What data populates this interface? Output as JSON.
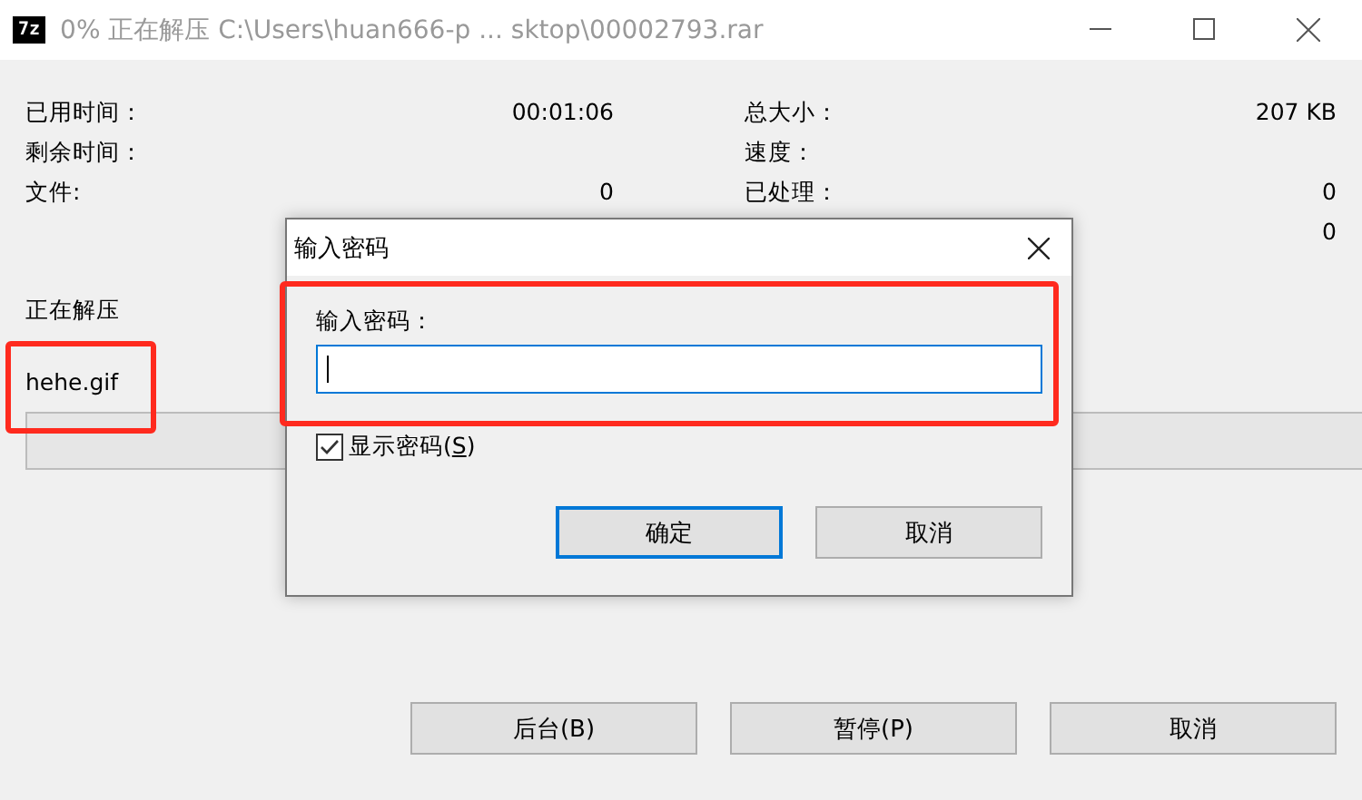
{
  "window": {
    "icon_text": "7z",
    "title": "0% 正在解压 C:\\Users\\huan666-p ... sktop\\00002793.rar"
  },
  "stats_left": [
    {
      "label": "已用时间：",
      "value": "00:01:06"
    },
    {
      "label": "剩余时间："
    },
    {
      "label": "文件:",
      "value": "0"
    }
  ],
  "stats_right": [
    {
      "label": "总大小：",
      "value": "207 KB"
    },
    {
      "label": "速度："
    },
    {
      "label": "已处理：",
      "value": "0"
    },
    {
      "value": "0"
    }
  ],
  "status_label": "正在解压",
  "current_file": "hehe.gif",
  "progress": {
    "level": 0
  },
  "buttons": [
    "后台(B)",
    "暂停(P)",
    "取消"
  ],
  "dialog": {
    "title": "输入密码",
    "field_label": "输入密码：",
    "password_focused": true,
    "show_password": {
      "label_before": "显示密码(",
      "access_key": "S",
      "label_after": ")",
      "checked": true
    },
    "buttons": [
      {
        "label": "确定",
        "default": true
      },
      {
        "label": "取消",
        "default": false
      }
    ]
  }
}
